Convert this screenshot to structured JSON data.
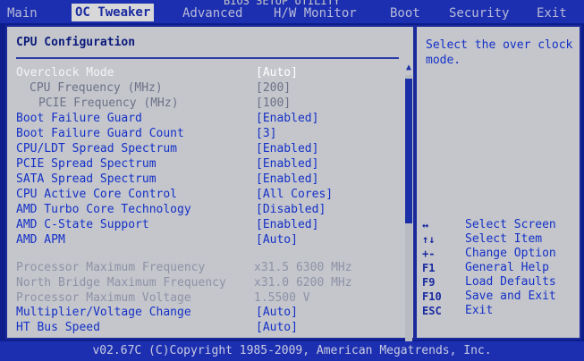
{
  "window_title": "BIOS SETUP UTILITY",
  "tabs": [
    {
      "label": "Main",
      "active": false
    },
    {
      "label": "OC Tweaker",
      "active": true
    },
    {
      "label": "Advanced",
      "active": false
    },
    {
      "label": "H/W Monitor",
      "active": false
    },
    {
      "label": "Boot",
      "active": false
    },
    {
      "label": "Security",
      "active": false
    },
    {
      "label": "Exit",
      "active": false
    }
  ],
  "section_title": "CPU Configuration",
  "settings": [
    {
      "label": "Overclock Mode",
      "value": "[Auto]"
    },
    {
      "label": "CPU Frequency (MHz)",
      "value": "[200]"
    },
    {
      "label": "PCIE Frequency (MHz)",
      "value": "[100]"
    },
    {
      "label": "Boot Failure Guard",
      "value": "[Enabled]"
    },
    {
      "label": "Boot Failure Guard Count",
      "value": "[3]"
    },
    {
      "label": "CPU/LDT Spread Spectrum",
      "value": "[Enabled]"
    },
    {
      "label": "PCIE Spread Spectrum",
      "value": "[Enabled]"
    },
    {
      "label": "SATA Spread Spectrum",
      "value": "[Enabled]"
    },
    {
      "label": "CPU Active Core Control",
      "value": "[All Cores]"
    },
    {
      "label": "AMD Turbo Core Technology",
      "value": "[Disabled]"
    },
    {
      "label": "AMD C-State Support",
      "value": "[Enabled]"
    },
    {
      "label": "AMD APM",
      "value": "[Auto]"
    }
  ],
  "info": [
    {
      "label": "Processor Maximum Frequency",
      "value": "x31.5 6300 MHz"
    },
    {
      "label": "North Bridge Maximum Frequency",
      "value": "x31.0 6200 MHz"
    },
    {
      "label": "Processor Maximum Voltage",
      "value": "1.5500 V"
    }
  ],
  "settings2": [
    {
      "label": "Multiplier/Voltage Change",
      "value": "[Auto]"
    },
    {
      "label": "HT Bus Speed",
      "value": "[Auto]"
    }
  ],
  "help_text": "Select the over clock mode.",
  "keys": [
    {
      "key": "↔",
      "desc": "Select Screen"
    },
    {
      "key": "↑↓",
      "desc": "Select Item"
    },
    {
      "key": "+-",
      "desc": "Change Option"
    },
    {
      "key": "F1",
      "desc": "General Help"
    },
    {
      "key": "F9",
      "desc": "Load Defaults"
    },
    {
      "key": "F10",
      "desc": "Save and Exit"
    },
    {
      "key": "ESC",
      "desc": "Exit"
    }
  ],
  "footer": "v02.67C (C)Copyright 1985-2009, American Megatrends, Inc."
}
